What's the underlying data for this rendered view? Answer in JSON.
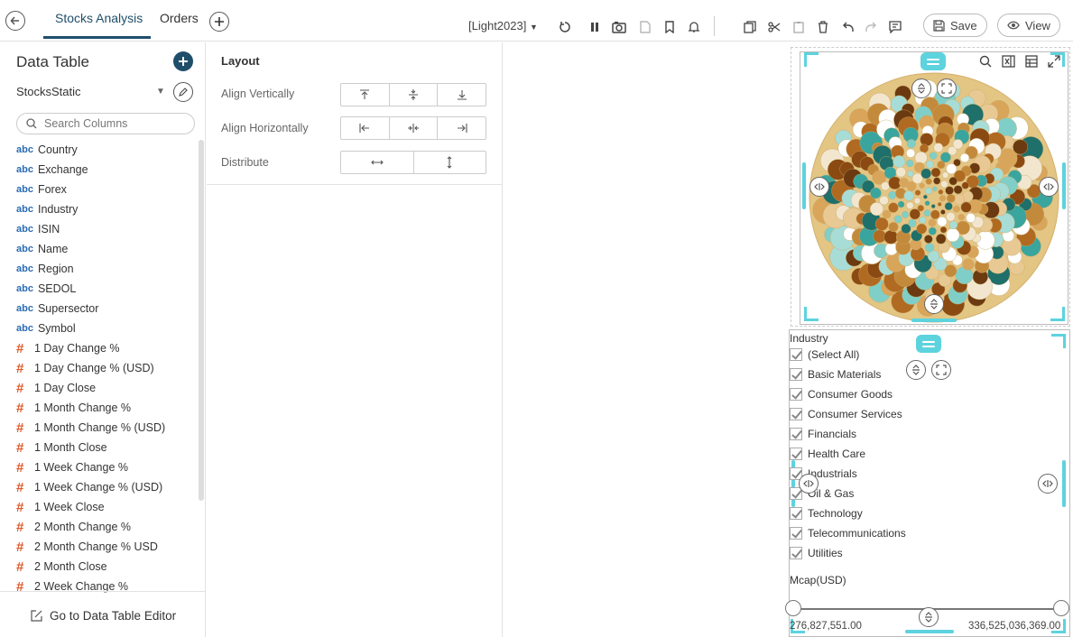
{
  "topbar": {
    "tabs": [
      {
        "label": "Stocks Analysis",
        "active": true
      },
      {
        "label": "Orders",
        "active": false
      }
    ],
    "theme_label": "[Light2023]",
    "save_label": "Save",
    "view_label": "View"
  },
  "data_table": {
    "title": "Data Table",
    "source": "StocksStatic",
    "search_placeholder": "Search Columns",
    "text_type": "abc",
    "numeric_type": "#",
    "text_columns": [
      "Country",
      "Exchange",
      "Forex",
      "Industry",
      "ISIN",
      "Name",
      "Region",
      "SEDOL",
      "Supersector",
      "Symbol"
    ],
    "numeric_columns": [
      "1 Day Change %",
      "1 Day Change % (USD)",
      "1 Day Close",
      "1 Month Change %",
      "1 Month Change % (USD)",
      "1 Month Close",
      "1 Week Change %",
      "1 Week Change % (USD)",
      "1 Week Close",
      "2 Month Change %",
      "2 Month Change % USD",
      "2 Month Close",
      "2 Week Change %"
    ],
    "editor_link": "Go to Data Table Editor"
  },
  "layout_panel": {
    "title": "Layout",
    "align_vertically": "Align Vertically",
    "align_horizontally": "Align Horizontally",
    "distribute": "Distribute"
  },
  "filter": {
    "title": "Industry",
    "items": [
      "(Select All)",
      "Basic Materials",
      "Consumer Goods",
      "Consumer Services",
      "Financials",
      "Health Care",
      "Industrials",
      "Oil & Gas",
      "Technology",
      "Telecommunications",
      "Utilities"
    ],
    "range_title": "Mcap(USD)",
    "range_min": "276,827,551.00",
    "range_max": "336,525,036,369.00"
  },
  "colors": {
    "accent": "#5dd3de",
    "brand_dark": "#1f4e6b",
    "numeric_icon": "#e05a2b",
    "text_icon": "#2a6ab4",
    "bubble_bg": "#e3c584"
  }
}
